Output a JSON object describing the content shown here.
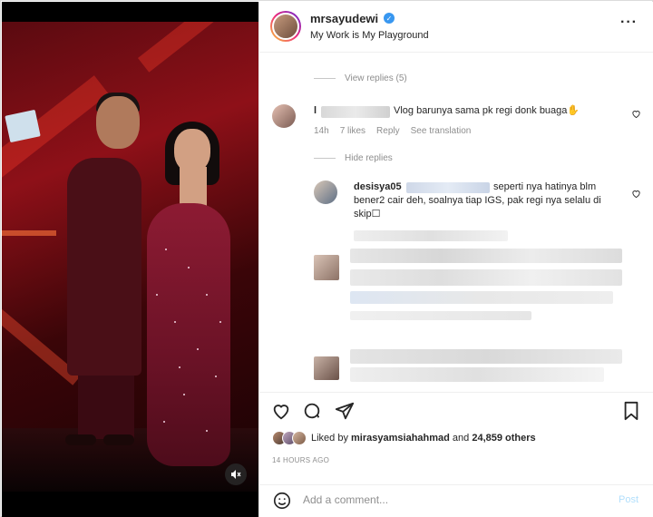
{
  "post": {
    "username": "mrsayudewi",
    "subtitle": "My Work is My Playground",
    "more_icon": "more-horizontal-icon"
  },
  "comments": {
    "view_replies_1": "View replies (5)",
    "comment1": {
      "username_prefix": "l",
      "text": "Vlog barunya sama pk regi donk buaga",
      "emoji": "✋",
      "time": "14h",
      "likes": "7 likes",
      "reply": "Reply",
      "translate": "See translation"
    },
    "hide_replies": "Hide replies",
    "reply1": {
      "username": "desisya05",
      "text": "seperti nya hatinya blm bener2 cair deh, soalnya tiap IGS, pak regi nya selalu di skip",
      "tail": "☐"
    }
  },
  "actions": {
    "liked_by_prefix": "Liked by ",
    "liked_by_user": "mirasyamsiahahmad",
    "liked_by_suffix": " and ",
    "liked_count": "24,859 others",
    "timestamp": "14 HOURS AGO"
  },
  "composer": {
    "placeholder": "Add a comment...",
    "post_label": "Post"
  },
  "colors": {
    "verified": "#3897f0",
    "link_disabled": "#b2dffc",
    "muted": "#8e8e8e"
  }
}
